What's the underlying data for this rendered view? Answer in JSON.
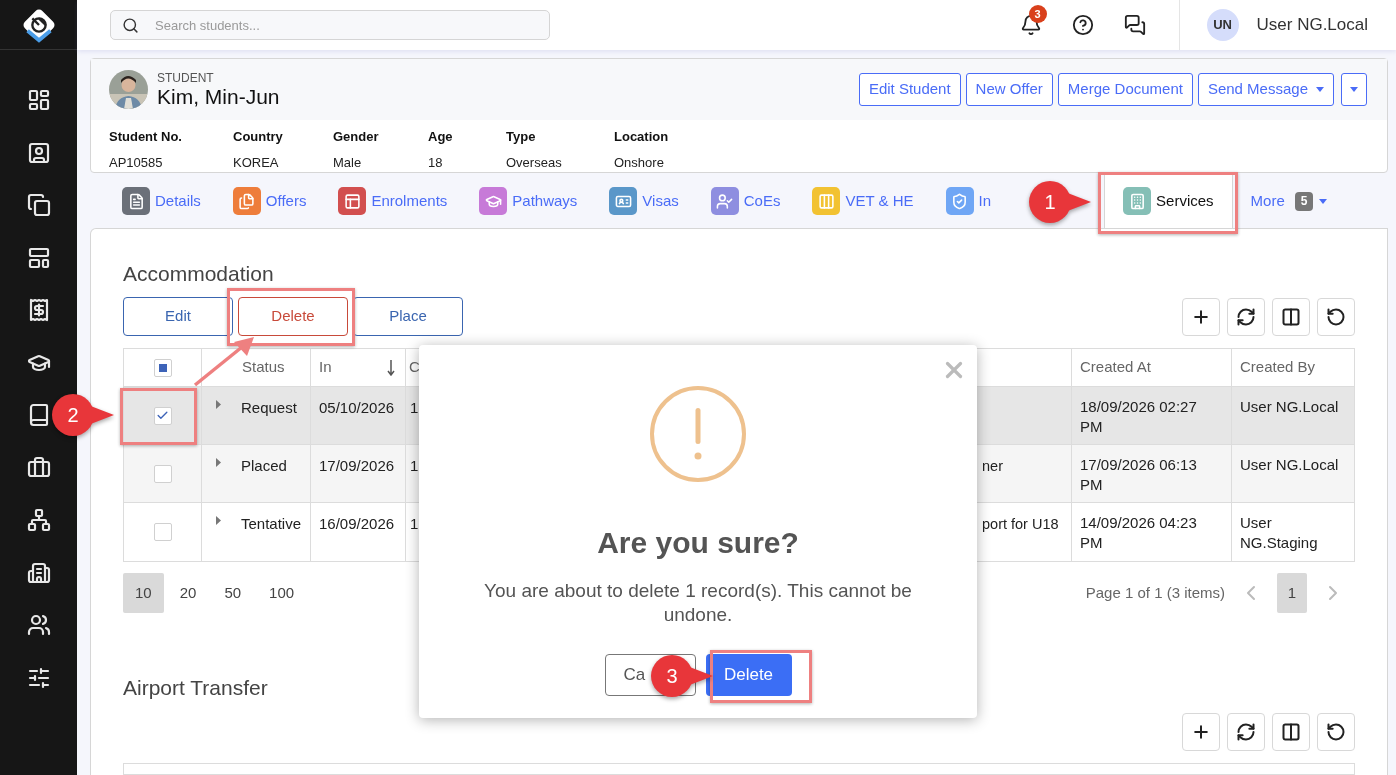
{
  "search": {
    "placeholder": "Search students..."
  },
  "notifications": {
    "count": "3"
  },
  "user": {
    "initials": "UN",
    "name": "User NG.Local"
  },
  "student": {
    "caption": "STUDENT",
    "name": "Kim, Min-Jun",
    "actions": [
      {
        "label": "Edit Student",
        "kind": "button"
      },
      {
        "label": "New Offer",
        "kind": "button"
      },
      {
        "label": "Merge Document",
        "kind": "button"
      },
      {
        "label": "Send Message",
        "kind": "dropdown"
      },
      {
        "kind": "caret"
      }
    ],
    "fields": [
      {
        "label": "Student No.",
        "value": "AP10585"
      },
      {
        "label": "Country",
        "value": "KOREA"
      },
      {
        "label": "Gender",
        "value": "Male"
      },
      {
        "label": "Age",
        "value": "18"
      },
      {
        "label": "Type",
        "value": "Overseas"
      },
      {
        "label": "Location",
        "value": "Onshore"
      }
    ]
  },
  "tabs": [
    {
      "label": "Details",
      "color": "#6b7079",
      "selected": false
    },
    {
      "label": "Offers",
      "color": "#ee7d3b",
      "selected": false
    },
    {
      "label": "Enrolments",
      "color": "#d24f4f",
      "selected": false
    },
    {
      "label": "Pathways",
      "color": "#c77ad8",
      "selected": false
    },
    {
      "label": "Visas",
      "color": "#5a97c9",
      "selected": false
    },
    {
      "label": "CoEs",
      "color": "#8e8ee0",
      "selected": false
    },
    {
      "label": "VET & HE",
      "color": "#f2c232",
      "selected": false
    },
    {
      "label": "In",
      "color": "#6fa6f5",
      "selected": false
    },
    {
      "label": "Services",
      "color": "#85bfb6",
      "selected": true
    },
    {
      "label": "More",
      "badge": "5",
      "kind": "more",
      "selected": false
    }
  ],
  "accommodation": {
    "title": "Accommodation",
    "actions": [
      {
        "label": "Edit",
        "kind": "default"
      },
      {
        "label": "Delete",
        "kind": "danger"
      },
      {
        "label": "Place",
        "kind": "default"
      }
    ],
    "header_checkbox_partial": true,
    "columns": [
      {
        "label": "Status"
      },
      {
        "label": "In",
        "sorted": true
      },
      {
        "label": "C"
      },
      {
        "label": "Created At"
      },
      {
        "label": "Created By"
      }
    ],
    "rows": [
      {
        "checked": true,
        "status": "Request",
        "in": "05/10/2026",
        "column_4": "1",
        "created_at": "18/09/2026 02:27 PM",
        "created_by": "User NG.Local"
      },
      {
        "checked": false,
        "status": "Placed",
        "in": "17/09/2026",
        "column_4": "1",
        "column_8": "ner",
        "created_at": "17/09/2026 06:13 PM",
        "created_by": "User NG.Local"
      },
      {
        "checked": false,
        "status": "Tentative",
        "in": "16/09/2026",
        "column_4": "1",
        "column_8": "port for U18",
        "created_at": "14/09/2026 04:23 PM",
        "created_by": "User NG.Staging"
      }
    ],
    "page_sizes": [
      {
        "label": "10",
        "selected": true
      },
      {
        "label": "20",
        "selected": false
      },
      {
        "label": "50",
        "selected": false
      },
      {
        "label": "100",
        "selected": false
      }
    ],
    "page_info": "Page 1 of 1 (3 items)",
    "pages": [
      {
        "label": "1",
        "selected": true
      }
    ]
  },
  "airport_transfer": {
    "title": "Airport Transfer"
  },
  "dialog": {
    "title": "Are you sure?",
    "message": "You are about to delete 1 record(s). This cannot be undone.",
    "cancel": "Ca",
    "confirm": "Delete"
  },
  "callouts": [
    {
      "label": "1"
    },
    {
      "label": "2"
    },
    {
      "label": "3"
    }
  ]
}
